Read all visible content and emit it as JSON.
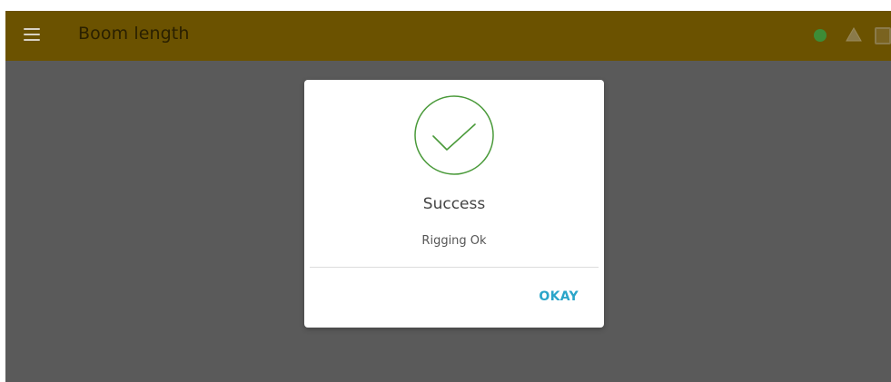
{
  "appbar": {
    "title": "Boom length",
    "menu_icon": "hamburger-menu-icon",
    "status_icons": [
      "green-status-dot-icon",
      "warning-triangle-icon",
      "square-icon"
    ],
    "colors": {
      "appbar": "#6b5200",
      "status_ok": "#3d8c36"
    }
  },
  "dialog": {
    "icon": "check-circle-icon",
    "title": "Success",
    "message": "Rigging Ok",
    "okay_label": "OKAY",
    "colors": {
      "check": "#4a9a3a",
      "button": "#2aa5c9"
    }
  }
}
